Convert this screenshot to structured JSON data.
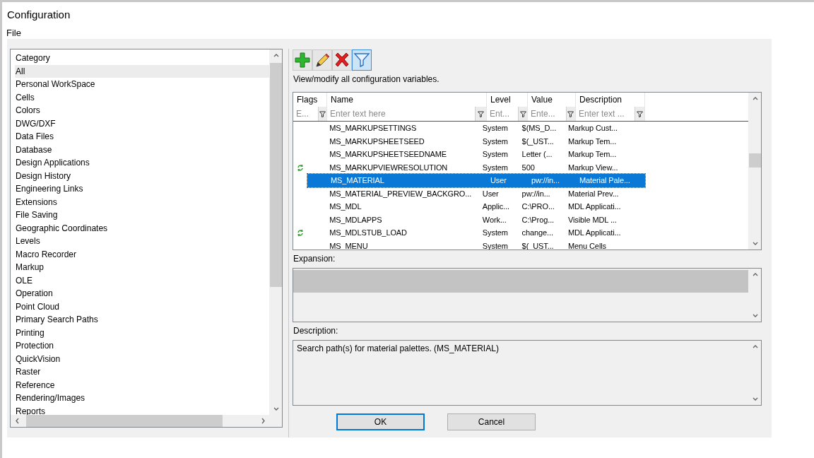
{
  "window": {
    "title": "Configuration"
  },
  "menu": [
    "File"
  ],
  "categories": {
    "header": "Category",
    "items": [
      {
        "label": "All",
        "selected": true
      },
      {
        "label": "Personal WorkSpace",
        "selected": false
      },
      {
        "label": "Cells",
        "selected": false
      },
      {
        "label": "Colors",
        "selected": false
      },
      {
        "label": "DWG/DXF",
        "selected": false
      },
      {
        "label": "Data Files",
        "selected": false
      },
      {
        "label": "Database",
        "selected": false
      },
      {
        "label": "Design Applications",
        "selected": false
      },
      {
        "label": "Design History",
        "selected": false
      },
      {
        "label": "Engineering Links",
        "selected": false
      },
      {
        "label": "Extensions",
        "selected": false
      },
      {
        "label": "File Saving",
        "selected": false
      },
      {
        "label": "Geographic Coordinates",
        "selected": false
      },
      {
        "label": "Levels",
        "selected": false
      },
      {
        "label": "Macro Recorder",
        "selected": false
      },
      {
        "label": "Markup",
        "selected": false
      },
      {
        "label": "OLE",
        "selected": false
      },
      {
        "label": "Operation",
        "selected": false
      },
      {
        "label": "Point Cloud",
        "selected": false
      },
      {
        "label": "Primary Search Paths",
        "selected": false
      },
      {
        "label": "Printing",
        "selected": false
      },
      {
        "label": "Protection",
        "selected": false
      },
      {
        "label": "QuickVision",
        "selected": false
      },
      {
        "label": "Raster",
        "selected": false
      },
      {
        "label": "Reference",
        "selected": false
      },
      {
        "label": "Rendering/Images",
        "selected": false
      },
      {
        "label": "Reports",
        "selected": false
      }
    ]
  },
  "toolbar": [
    {
      "kind": "add",
      "selected": false
    },
    {
      "kind": "edit",
      "selected": false
    },
    {
      "kind": "delete",
      "selected": false
    },
    {
      "kind": "filter",
      "selected": true
    }
  ],
  "hint": "View/modify all configuration variables.",
  "table": {
    "columns": [
      {
        "label": "Flags",
        "placeholder": "E..."
      },
      {
        "label": "Name",
        "placeholder": "Enter text here"
      },
      {
        "label": "Level",
        "placeholder": "Ent..."
      },
      {
        "label": "Value",
        "placeholder": "Ente..."
      },
      {
        "label": "Description",
        "placeholder": "Enter text ..."
      }
    ],
    "rows": [
      {
        "flag": false,
        "name": "MS_MARKUPSETTINGS",
        "level": "System",
        "value": "$(MS_D...",
        "description": "Markup Cust...",
        "selected": false
      },
      {
        "flag": false,
        "name": "MS_MARKUPSHEETSEED",
        "level": "System",
        "value": "$(_UST...",
        "description": "Markup Tem...",
        "selected": false
      },
      {
        "flag": false,
        "name": "MS_MARKUPSHEETSEEDNAME",
        "level": "System",
        "value": "Letter (...",
        "description": "Markup Tem...",
        "selected": false
      },
      {
        "flag": true,
        "name": "MS_MARKUPVIEWRESOLUTION",
        "level": "System",
        "value": "500",
        "description": "Markup View...",
        "selected": false
      },
      {
        "flag": false,
        "name": "MS_MATERIAL",
        "level": "User",
        "value": "pw://in...",
        "description": "Material Pale...",
        "selected": true
      },
      {
        "flag": false,
        "name": "MS_MATERIAL_PREVIEW_BACKGRO...",
        "level": "User",
        "value": "pw://in...",
        "description": "Material Prev...",
        "selected": false
      },
      {
        "flag": false,
        "name": "MS_MDL",
        "level": "Applic...",
        "value": "C:\\PRO...",
        "description": "MDL Applicati...",
        "selected": false
      },
      {
        "flag": false,
        "name": "MS_MDLAPPS",
        "level": "Work...",
        "value": "C:\\Prog...",
        "description": "Visible MDL ...",
        "selected": false
      },
      {
        "flag": true,
        "name": "MS_MDLSTUB_LOAD",
        "level": "System",
        "value": "change...",
        "description": "MDL Applicati...",
        "selected": false
      },
      {
        "flag": false,
        "name": "MS_MENU",
        "level": "System",
        "value": "$(_UST...",
        "description": "Menu Cells",
        "selected": false
      }
    ]
  },
  "expansion": {
    "label": "Expansion:"
  },
  "description": {
    "label": "Description:",
    "text": "Search path(s) for material palettes.  (MS_MATERIAL)"
  },
  "buttons": [
    {
      "label": "OK",
      "default": true
    },
    {
      "label": "Cancel",
      "default": false
    }
  ]
}
